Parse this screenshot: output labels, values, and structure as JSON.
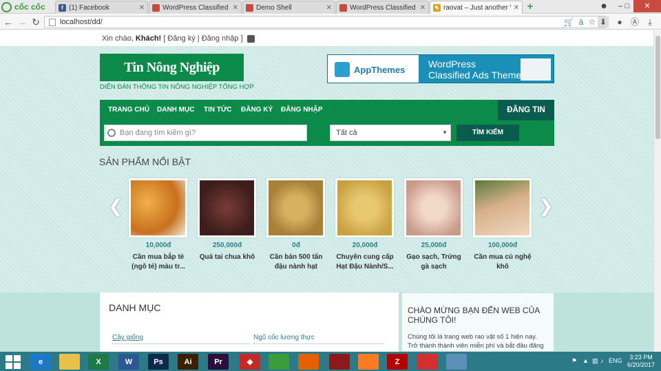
{
  "browser": {
    "brand": "cốc cốc",
    "tabs": [
      {
        "title": "(1) Facebook",
        "icon": "facebook-icon",
        "color": "#3b5998"
      },
      {
        "title": "WordPress Classified Ads",
        "icon": "page-icon",
        "color": "#c94a3f"
      },
      {
        "title": "Demo Shell",
        "icon": "page-icon",
        "color": "#c94a3f"
      },
      {
        "title": "WordPress Classified Ads",
        "icon": "page-icon",
        "color": "#c94a3f"
      },
      {
        "title": "raovat – Just another Wor",
        "icon": "pencil-icon",
        "color": "#e1a21a"
      }
    ],
    "url": "localhost/dd/"
  },
  "page": {
    "welcome_prefix": "Xin chào, ",
    "welcome_user": "Khách!",
    "welcome_links": " [ Đăng ký | Đăng nhập ]",
    "logo_text": "Tin Nông Nghiệp",
    "tagline": "DIỄN ĐÀN THÔNG TIN NÔNG NGHIỆP TỔNG HỢP",
    "banner": {
      "brand": "AppThemes",
      "line1": "WordPress",
      "line2": "Classified Ads Theme"
    },
    "nav": [
      "TRANG CHỦ",
      "DANH MỤC",
      "TIN TỨC",
      "ĐĂNG KÝ",
      "ĐĂNG NHẬP"
    ],
    "post_button": "ĐĂNG TIN",
    "search_placeholder": "Bạn đang tìm kiếm gì?",
    "category_select": "Tất cả",
    "search_button": "TÌM KIẾM",
    "featured_title": "SẢN PHẨM NỔI BẬT",
    "products": [
      {
        "price": "10,000đ",
        "name": "Cần mua bắp tẻ (ngô tẻ) màu tr...",
        "image": "corn",
        "color": "#d9892a"
      },
      {
        "price": "250,000đ",
        "name": "Quả tai chua khô",
        "image": "dried-fruit",
        "color": "#5a2f2a"
      },
      {
        "price": "0đ",
        "name": "Cần bán 500 tấn đậu nành hạt",
        "image": "soybean",
        "color": "#c9a24d"
      },
      {
        "price": "20,000đ",
        "name": "Chuyên cung cấp Hạt Đậu Nành/S...",
        "image": "soybean",
        "color": "#d8b65a"
      },
      {
        "price": "25,000đ",
        "name": "Gạo sạch, Trứng gà sạch",
        "image": "eggs",
        "color": "#e8c7b5"
      },
      {
        "price": "100,000đ",
        "name": "Cần mua củ nghệ khô",
        "image": "spa",
        "color": "#c8a07a"
      }
    ],
    "categories_title": "DANH MỤC",
    "categories": [
      "Cây giống",
      "Ngũ cốc lương thực"
    ],
    "welcome_title": "CHÀO MỪNG BẠN ĐẾN WEB CỦA CHÚNG TÔI!",
    "welcome_text": "Chúng tôi là trang web rao vặt số 1 hiện nay. Trở thành thành viên miễn phí và bắt đầu đăng tin"
  },
  "taskbar": {
    "apps": [
      {
        "name": "internet-explorer-icon",
        "label": "e",
        "color": "#1e78c8"
      },
      {
        "name": "file-explorer-icon",
        "label": "",
        "color": "#e8c04a"
      },
      {
        "name": "excel-icon",
        "label": "X",
        "color": "#1d7a45"
      },
      {
        "name": "word-icon",
        "label": "W",
        "color": "#2b5797"
      },
      {
        "name": "photoshop-icon",
        "label": "Ps",
        "color": "#0d2a4a"
      },
      {
        "name": "illustrator-icon",
        "label": "Ai",
        "color": "#3a1f00"
      },
      {
        "name": "premiere-icon",
        "label": "Pr",
        "color": "#2a0f3a"
      },
      {
        "name": "app-red-icon",
        "label": "◆",
        "color": "#c62828"
      },
      {
        "name": "coccoc-icon",
        "label": "",
        "color": "#3b9c3b"
      },
      {
        "name": "firefox-icon",
        "label": "",
        "color": "#e66000"
      },
      {
        "name": "eye-app-icon",
        "label": "",
        "color": "#8b1a1a"
      },
      {
        "name": "xampp-icon",
        "label": "",
        "color": "#fb7a24"
      },
      {
        "name": "filezilla-icon",
        "label": "Z",
        "color": "#b30000"
      },
      {
        "name": "record-icon",
        "label": "",
        "color": "#d32f2f"
      },
      {
        "name": "network-app-icon",
        "label": "",
        "color": "#5c8fb8"
      }
    ],
    "lang": "ENG",
    "time": "3:23 PM",
    "date": "6/20/2017"
  }
}
